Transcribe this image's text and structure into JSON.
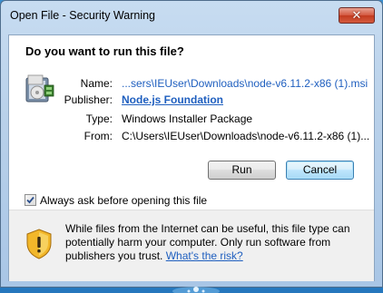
{
  "window": {
    "title": "Open File - Security Warning",
    "close_glyph": "✕"
  },
  "question": "Do you want to run this file?",
  "file_info": {
    "icon": "installer-package-icon",
    "name_label": "Name:",
    "name_value": "...sers\\IEUser\\Downloads\\node-v6.11.2-x86 (1).msi",
    "publisher_label": "Publisher:",
    "publisher_value": "Node.js Foundation",
    "type_label": "Type:",
    "type_value": "Windows Installer Package",
    "from_label": "From:",
    "from_value": "C:\\Users\\IEUser\\Downloads\\node-v6.11.2-x86 (1)..."
  },
  "buttons": {
    "run": "Run",
    "cancel": "Cancel"
  },
  "checkbox": {
    "label": "Always ask before opening this file",
    "checked": true
  },
  "warning": {
    "icon": "security-shield-warning-icon",
    "text": "While files from the Internet can be useful, this file type can potentially harm your computer. Only run software from publishers you trust.",
    "link": "What's the risk?"
  },
  "colors": {
    "link": "#1f5fbf",
    "desktop": "#2677bd"
  }
}
